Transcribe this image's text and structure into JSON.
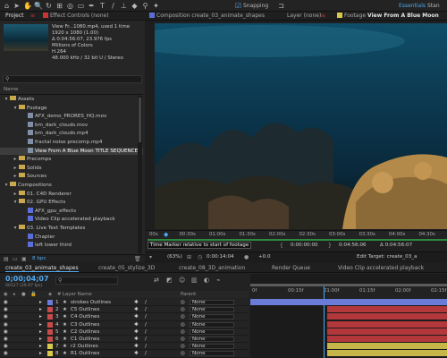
{
  "toolbar": {
    "snapping": "Snapping",
    "essentials": "Essentials",
    "standard": "Stan"
  },
  "project": {
    "tab_project": "Project",
    "tab_effects": "Effect Controls (none)",
    "footage_name": "View Fr...1080.mp4",
    "footage_used": ", used 1 time",
    "footage_info": [
      "1920 x 1080 (1.00)",
      "Δ 0:04:56:07, 23.976 fps",
      "Millions of Colors",
      "H.264",
      "48.000 kHz / 32 bit U / Stereo"
    ],
    "search_placeholder": "",
    "col_name": "Name",
    "items": [
      {
        "label": "Assets",
        "kind": "folder",
        "indent": 0,
        "open": true
      },
      {
        "label": "Footage",
        "kind": "folder",
        "indent": 1,
        "open": true
      },
      {
        "label": "AFX_demo_PRORES_HQ.mov",
        "kind": "file",
        "indent": 2
      },
      {
        "label": "bm_dark_clouds.mov",
        "kind": "file",
        "indent": 2
      },
      {
        "label": "bm_dark_clouds.mp4",
        "kind": "file",
        "indent": 2
      },
      {
        "label": "fractal noise precomp.mp4",
        "kind": "file",
        "indent": 2
      },
      {
        "label": "View From A Blue Moon TITLE SEQUENCE",
        "kind": "file",
        "indent": 2,
        "selected": true
      },
      {
        "label": "Precomps",
        "kind": "folder",
        "indent": 1
      },
      {
        "label": "Solids",
        "kind": "folder",
        "indent": 1
      },
      {
        "label": "Sources",
        "kind": "folder",
        "indent": 1
      },
      {
        "label": "Compositions",
        "kind": "folder",
        "indent": 0,
        "open": true
      },
      {
        "label": "01. C4D Renderer",
        "kind": "folder",
        "indent": 1
      },
      {
        "label": "02. GPU Effects",
        "kind": "folder",
        "indent": 1,
        "open": true
      },
      {
        "label": "AFX_gpu_effects",
        "kind": "comp",
        "indent": 2
      },
      {
        "label": "Video Clip accelerated playback",
        "kind": "comp",
        "indent": 2
      },
      {
        "label": "03. Live Text Templates",
        "kind": "folder",
        "indent": 1,
        "open": true
      },
      {
        "label": "Chapter",
        "kind": "comp",
        "indent": 2
      },
      {
        "label": "left lower third",
        "kind": "comp",
        "indent": 2
      }
    ],
    "bpc": "8 bpc"
  },
  "viewer": {
    "tab_comp": "Composition create_03_animate_shapes",
    "tab_layer": "Layer (none)",
    "tab_footage": "Footage",
    "tab_footage_name": "View From A Blue Moon",
    "ruler": [
      "00s",
      "00:30s",
      "01:00s",
      "01:30s",
      "02:00s",
      "02:30s",
      "03:00s",
      "03:30s",
      "04:00s",
      "04:30s"
    ],
    "tooltip": "Time Marker relative to start of footage",
    "start": "0:00:00:00",
    "end": "0:04:56:06",
    "duration": "Δ 0:04:56:07",
    "zoom": "(63%)",
    "current": "0:00:14:04",
    "offset": "+0.0",
    "edit_target": "Edit Target: create_03_a"
  },
  "timeline": {
    "tabs": [
      "create_03_animate_shapes",
      "create_05_stylize_3D",
      "create_08_3D_animation",
      "Render Queue",
      "Video Clip accelerated playback"
    ],
    "timecode": "0;00;04;07",
    "timecode_sub": "00127 (29.97 fps)",
    "search_placeholder": "",
    "col_layer": "Layer Name",
    "col_parent": "Parent",
    "ruler": [
      "0f",
      "00:15f",
      "01:00f",
      "01:15f",
      "02:00f",
      "02:15f"
    ],
    "layers": [
      {
        "num": "1",
        "name": "strokes Outlines",
        "color": "#6a7bd8",
        "parent": "None",
        "bar": "#6a7bd8"
      },
      {
        "num": "2",
        "name": "C5 Outlines",
        "color": "#c94a4a",
        "parent": "None",
        "bar": "#b2383c"
      },
      {
        "num": "3",
        "name": "C4 Outlines",
        "color": "#c94a4a",
        "parent": "None",
        "bar": "#b2383c"
      },
      {
        "num": "4",
        "name": "C3 Outlines",
        "color": "#c94a4a",
        "parent": "None",
        "bar": "#b2383c"
      },
      {
        "num": "5",
        "name": "C2 Outlines",
        "color": "#c94a4a",
        "parent": "None",
        "bar": "#b2383c"
      },
      {
        "num": "6",
        "name": "C1 Outlines",
        "color": "#c94a4a",
        "parent": "None",
        "bar": "#b2383c"
      },
      {
        "num": "7",
        "name": "r2 Outlines",
        "color": "#d8c94a",
        "parent": "None",
        "bar": "#c6b64a"
      },
      {
        "num": "8",
        "name": "R1 Outlines",
        "color": "#d8c94a",
        "parent": "None",
        "bar": "#c6b64a"
      }
    ]
  }
}
